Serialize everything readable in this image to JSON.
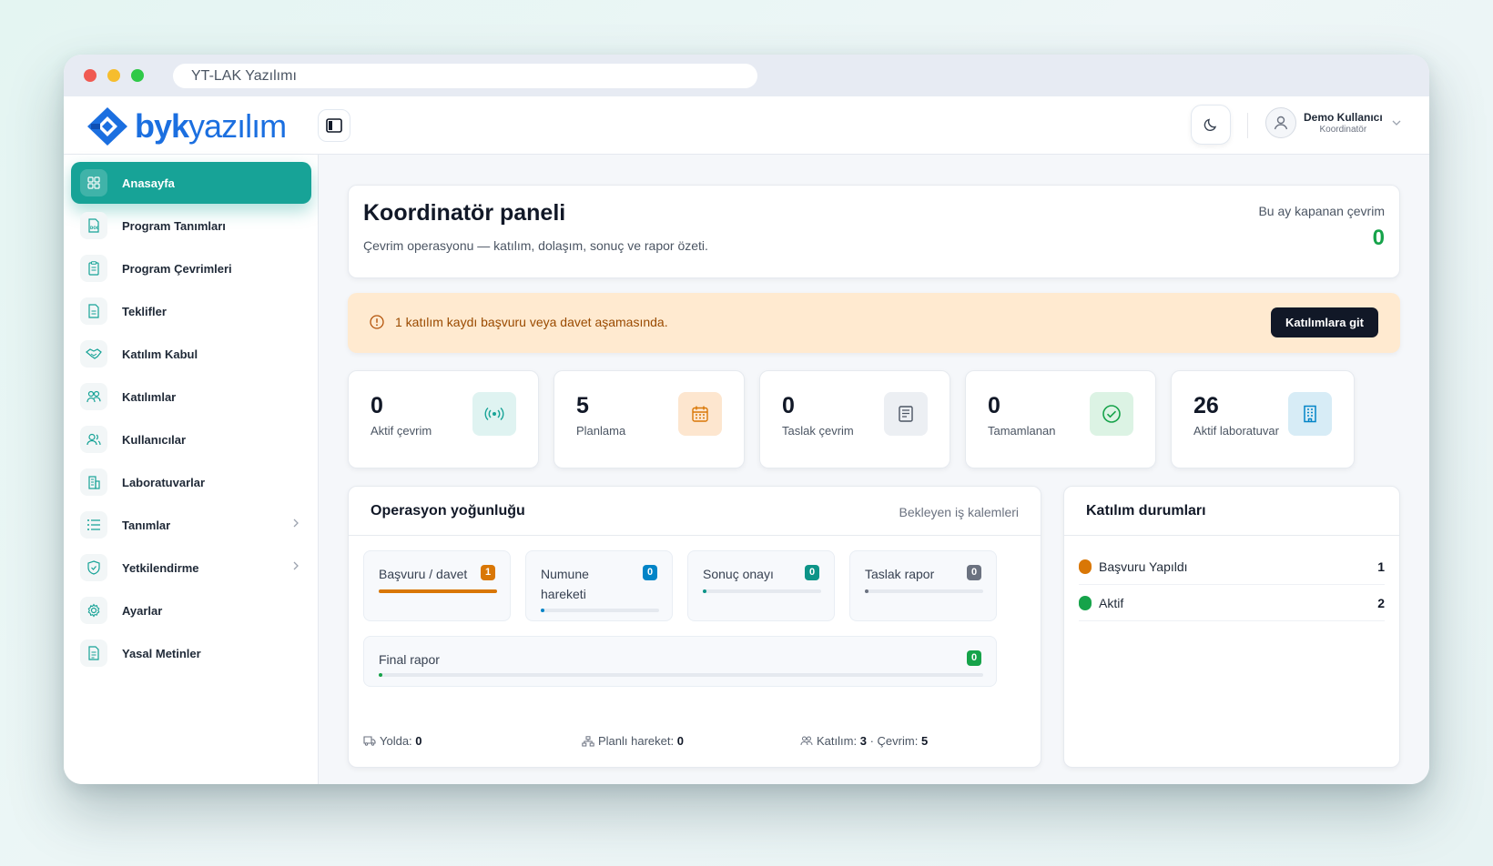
{
  "window": {
    "url_title": "YT-LAK Yazılımı"
  },
  "header": {
    "logo_bold": "byk",
    "logo_light": "yazılım",
    "user_name": "Demo Kullanıcı",
    "user_role": "Koordinatör"
  },
  "sidebar": {
    "items": [
      {
        "label": "Anasayfa",
        "icon": "grid-icon",
        "active": true
      },
      {
        "label": "Program Tanımları",
        "icon": "doc-file-icon"
      },
      {
        "label": "Program Çevrimleri",
        "icon": "clipboard-icon"
      },
      {
        "label": "Teklifler",
        "icon": "file-text-icon"
      },
      {
        "label": "Katılım Kabul",
        "icon": "handshake-icon"
      },
      {
        "label": "Katılımlar",
        "icon": "users-icon"
      },
      {
        "label": "Kullanıcılar",
        "icon": "user-group-icon"
      },
      {
        "label": "Laboratuvarlar",
        "icon": "building-icon"
      },
      {
        "label": "Tanımlar",
        "icon": "list-icon",
        "has_children": true
      },
      {
        "label": "Yetkilendirme",
        "icon": "shield-check-icon",
        "has_children": true
      },
      {
        "label": "Ayarlar",
        "icon": "gear-icon"
      },
      {
        "label": "Yasal Metinler",
        "icon": "document-icon"
      }
    ]
  },
  "hero": {
    "title": "Koordinatör paneli",
    "subtitle": "Çevrim operasyonu — katılım, dolaşım, sonuç ve rapor özeti.",
    "right_label": "Bu ay kapanan çevrim",
    "right_value": "0"
  },
  "alert": {
    "text": "1 katılım kaydı başvuru veya davet aşamasında.",
    "button": "Katılımlara git"
  },
  "stats": [
    {
      "value": "0",
      "label": "Aktif çevrim",
      "icon": "broadcast-icon",
      "bg": "#dff3f1",
      "fg": "#17a397"
    },
    {
      "value": "5",
      "label": "Planlama",
      "icon": "calendar-icon",
      "bg": "#fde6cf",
      "fg": "#d97706"
    },
    {
      "value": "0",
      "label": "Taslak çevrim",
      "icon": "draft-icon",
      "bg": "#eceff3",
      "fg": "#4b5563"
    },
    {
      "value": "0",
      "label": "Tamamlanan",
      "icon": "check-circle-icon",
      "bg": "#dcf3e4",
      "fg": "#16a34a"
    },
    {
      "value": "26",
      "label": "Aktif laboratuvar",
      "icon": "building-icon",
      "bg": "#d7ecf6",
      "fg": "#0284c7"
    }
  ],
  "ops": {
    "title": "Operasyon yoğunluğu",
    "right": "Bekleyen iş kalemleri",
    "tiles": [
      {
        "label": "Başvuru / davet",
        "count": "1",
        "color": "#d97706",
        "progress": 1.0
      },
      {
        "label": "Numune hareketi",
        "count": "0",
        "color": "#0284c7",
        "progress": 0
      },
      {
        "label": "Sonuç onayı",
        "count": "0",
        "color": "#0d9488",
        "progress": 0
      },
      {
        "label": "Taslak rapor",
        "count": "0",
        "color": "#6b7280",
        "progress": 0
      },
      {
        "label": "Final rapor",
        "count": "0",
        "color": "#16a34a",
        "progress": 0
      }
    ],
    "footer": {
      "yolda_label": "Yolda:",
      "yolda_val": "0",
      "planli_label": "Planlı hareket:",
      "planli_val": "0",
      "katilim_label": "Katılım:",
      "katilim_val": "3",
      "sep": "·",
      "cevrim_label": "Çevrim:",
      "cevrim_val": "5"
    }
  },
  "katilim": {
    "title": "Katılım durumları",
    "rows": [
      {
        "name": "Başvuru Yapıldı",
        "count": "1",
        "color": "#d97706"
      },
      {
        "name": "Aktif",
        "count": "2",
        "color": "#16a34a"
      }
    ]
  }
}
